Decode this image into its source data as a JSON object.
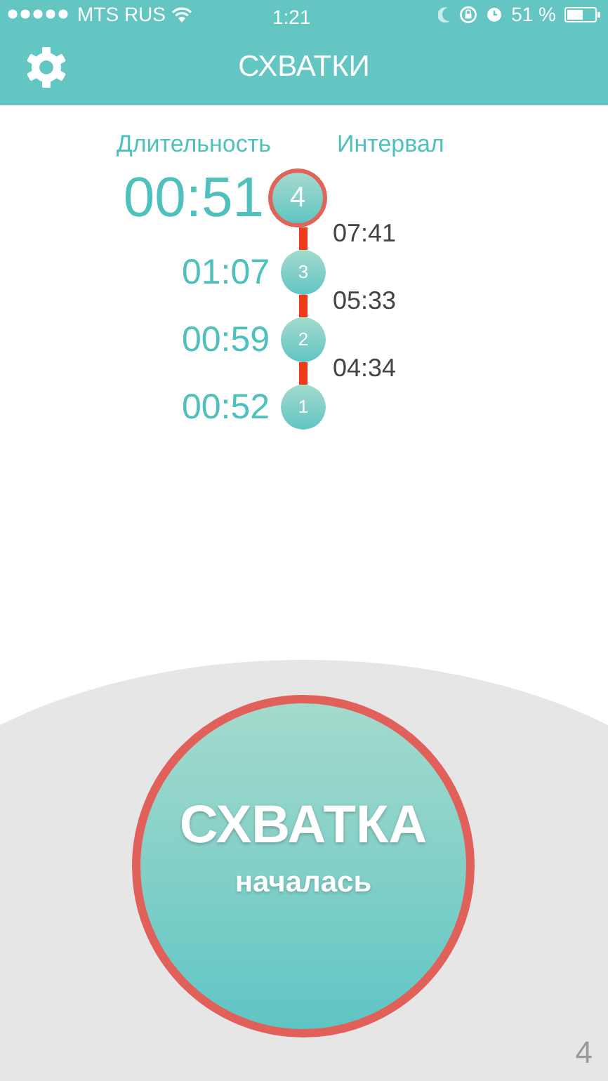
{
  "status_bar": {
    "carrier": "MTS RUS",
    "time": "1:21",
    "battery": "51 %"
  },
  "header": {
    "title": "СХВАТКИ"
  },
  "columns": {
    "duration": "Длительность",
    "interval": "Интервал"
  },
  "contractions": [
    {
      "number": "4",
      "duration": "00:51",
      "interval": "07:41",
      "selected": true
    },
    {
      "number": "3",
      "duration": "01:07",
      "interval": "05:33",
      "selected": false
    },
    {
      "number": "2",
      "duration": "00:59",
      "interval": "04:34",
      "selected": false
    },
    {
      "number": "1",
      "duration": "00:52",
      "selected": false
    }
  ],
  "main_button": {
    "title": "СХВАТКА",
    "subtitle": "началась"
  },
  "counter": "4"
}
